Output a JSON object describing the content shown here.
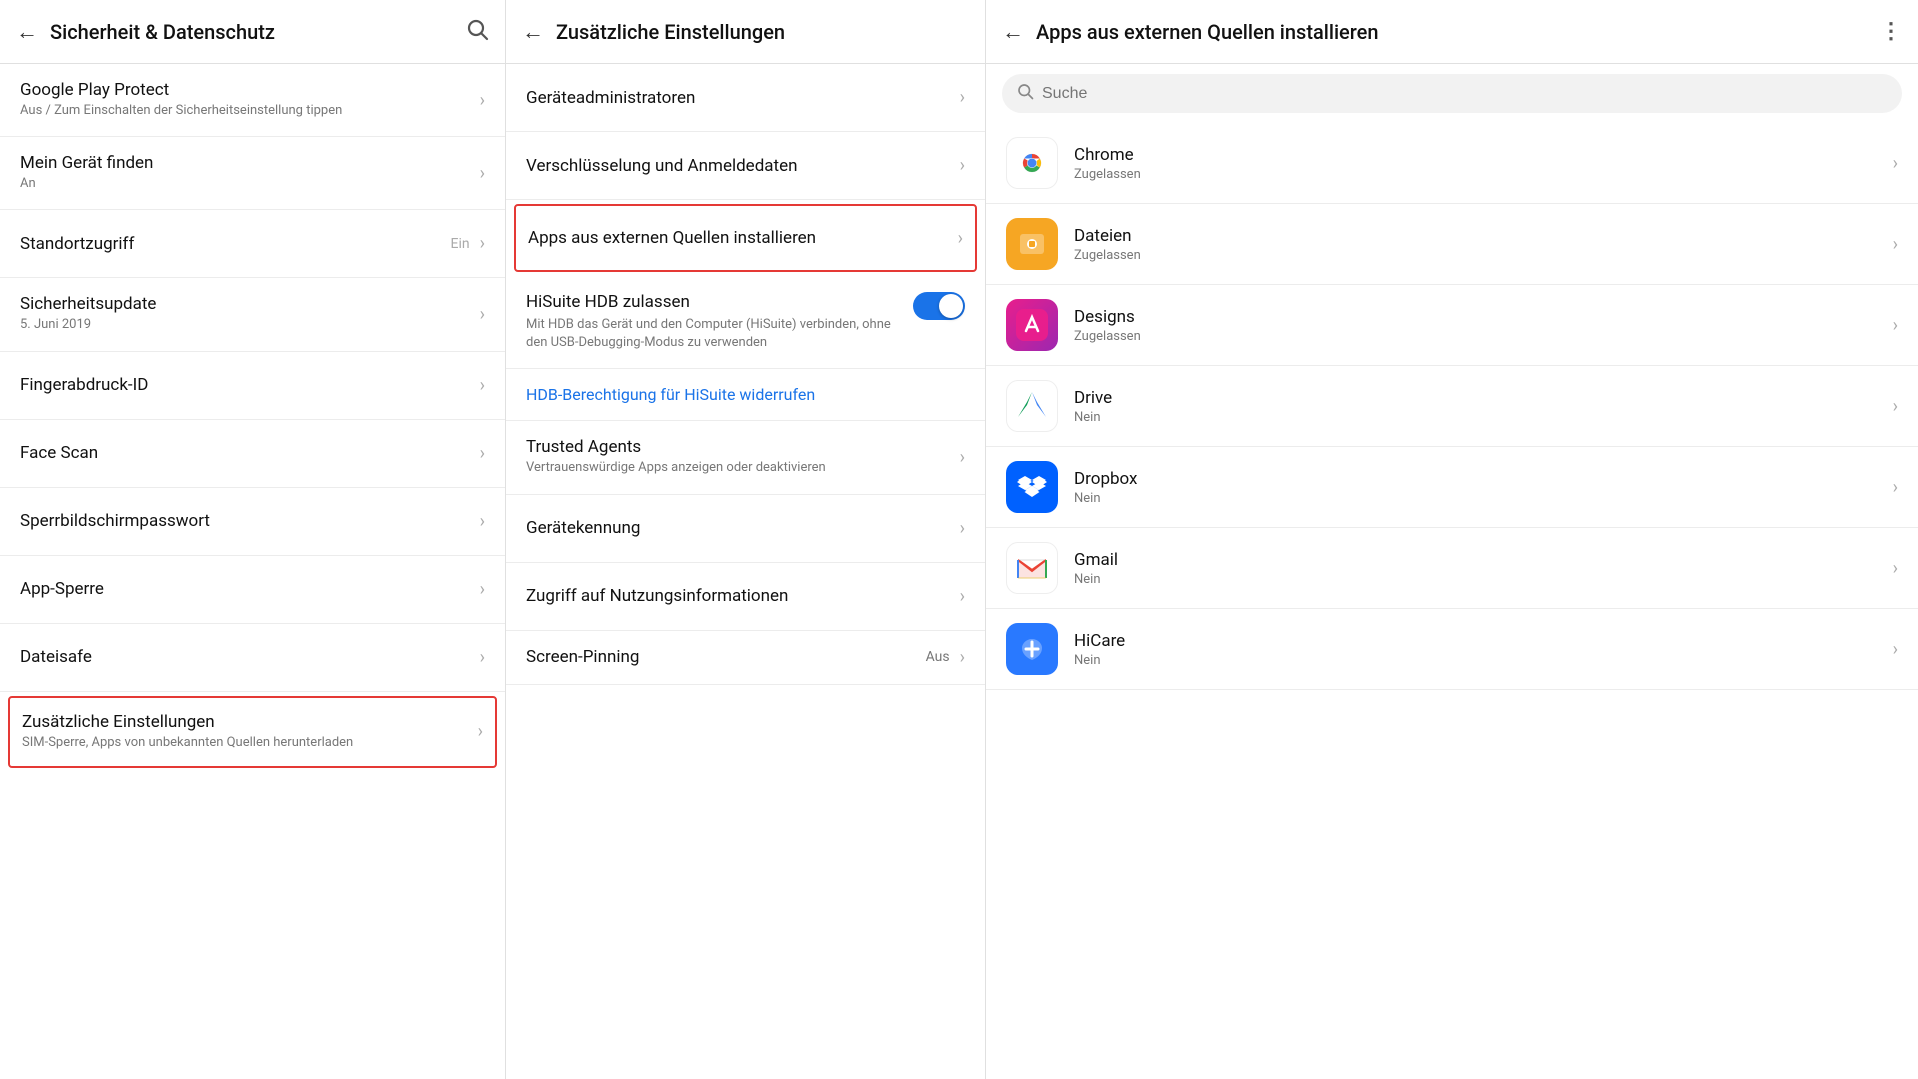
{
  "panels": {
    "left": {
      "header": {
        "back_label": "←",
        "title": "Sicherheit & Datenschutz",
        "search_icon": "🔍"
      },
      "items": [
        {
          "id": "google-play-protect",
          "title": "Google Play Protect",
          "sub": "Aus / Zum Einschalten der Sicherheitseinstellung tippen",
          "right": "",
          "highlighted": false
        },
        {
          "id": "mein-gerat-finden",
          "title": "Mein Gerät finden",
          "sub": "An",
          "right": "",
          "highlighted": false
        },
        {
          "id": "standortzugriff",
          "title": "Standortzugriff",
          "sub": "",
          "right": "Ein",
          "highlighted": false
        },
        {
          "id": "sicherheitsupdate",
          "title": "Sicherheitsupdate",
          "sub": "5. Juni 2019",
          "right": "",
          "highlighted": false
        },
        {
          "id": "fingerabdruck-id",
          "title": "Fingerabdruck-ID",
          "sub": "",
          "right": "",
          "highlighted": false
        },
        {
          "id": "face-scan",
          "title": "Face Scan",
          "sub": "",
          "right": "",
          "highlighted": false
        },
        {
          "id": "sperrbildschirmpasswort",
          "title": "Sperrbildschirmpasswort",
          "sub": "",
          "right": "",
          "highlighted": false
        },
        {
          "id": "app-sperre",
          "title": "App-Sperre",
          "sub": "",
          "right": "",
          "highlighted": false
        },
        {
          "id": "dateisafe",
          "title": "Dateisafe",
          "sub": "",
          "right": "",
          "highlighted": false
        },
        {
          "id": "zusatzliche-einstellungen",
          "title": "Zusätzliche Einstellungen",
          "sub": "SIM-Sperre, Apps von unbekannten Quellen herunterladen",
          "right": "",
          "highlighted": true
        }
      ]
    },
    "mid": {
      "header": {
        "back_label": "←",
        "title": "Zusätzliche Einstellungen"
      },
      "items": [
        {
          "id": "geratadministratoren",
          "title": "Geräteadministratoren",
          "type": "simple",
          "highlighted": false
        },
        {
          "id": "verschlusselung",
          "title": "Verschlüsselung und Anmeldedaten",
          "type": "simple",
          "highlighted": false
        },
        {
          "id": "apps-extern",
          "title": "Apps aus externen Quellen installieren",
          "type": "simple",
          "highlighted": true
        },
        {
          "id": "hisuite-hdb",
          "title": "HiSuite HDB zulassen",
          "sub": "Mit HDB das Gerät und den Computer (HiSuite) verbinden, ohne den USB-Debugging-Modus zu verwenden",
          "type": "toggle",
          "toggle_on": true,
          "highlighted": false
        },
        {
          "id": "hdb-berechtigung",
          "title": "HDB-Berechtigung für HiSuite widerrufen",
          "type": "link",
          "highlighted": false
        },
        {
          "id": "trusted-agents",
          "title": "Trusted Agents",
          "sub": "Vertrauenswürdige Apps anzeigen oder deaktivieren",
          "type": "simple",
          "highlighted": false
        },
        {
          "id": "geratekennung",
          "title": "Gerätekennung",
          "type": "simple",
          "highlighted": false
        },
        {
          "id": "zugriff-nutzungsinformationen",
          "title": "Zugriff auf Nutzungsinformationen",
          "type": "simple",
          "highlighted": false
        },
        {
          "id": "screen-pinning",
          "title": "Screen-Pinning",
          "value": "Aus",
          "type": "value",
          "highlighted": false
        }
      ]
    },
    "right": {
      "header": {
        "back_label": "←",
        "title": "Apps aus externen Quellen installieren",
        "more_icon": "⋮"
      },
      "search_placeholder": "Suche",
      "apps": [
        {
          "id": "chrome",
          "name": "Chrome",
          "status": "Zugelassen",
          "icon_type": "chrome"
        },
        {
          "id": "dateien",
          "name": "Dateien",
          "status": "Zugelassen",
          "icon_type": "dateien"
        },
        {
          "id": "designs",
          "name": "Designs",
          "status": "Zugelassen",
          "icon_type": "designs"
        },
        {
          "id": "drive",
          "name": "Drive",
          "status": "Nein",
          "icon_type": "drive"
        },
        {
          "id": "dropbox",
          "name": "Dropbox",
          "status": "Nein",
          "icon_type": "dropbox"
        },
        {
          "id": "gmail",
          "name": "Gmail",
          "status": "Nein",
          "icon_type": "gmail"
        },
        {
          "id": "hicare",
          "name": "HiCare",
          "status": "Nein",
          "icon_type": "hicare"
        }
      ]
    }
  }
}
